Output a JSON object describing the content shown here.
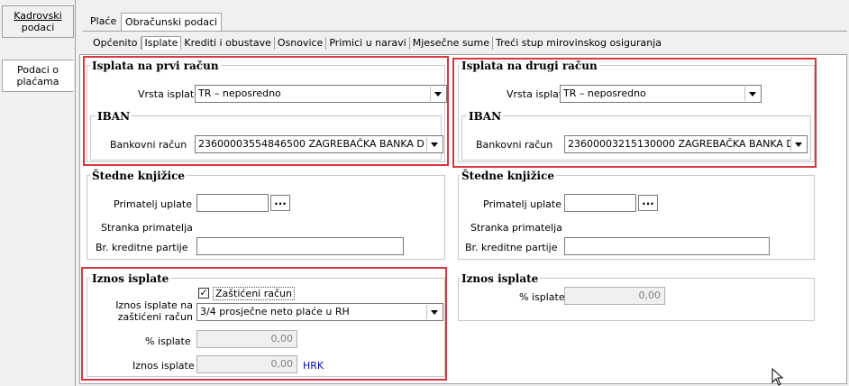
{
  "left_tabs": [
    {
      "label_line1": "Kadrovski",
      "label_line2": "podaci"
    },
    {
      "label_line1": "Podaci o",
      "label_line2": "plaćama"
    }
  ],
  "top_tabs": [
    "Plaće",
    "Obračunski podaci"
  ],
  "sub_tabs": [
    "Općenito",
    "Isplate",
    "Krediti i obustave",
    "Osnovice",
    "Primici u naravi",
    "Mjesečne sume",
    "Treći stup mirovinskog osiguranja"
  ],
  "first_account": {
    "title": "Isplata na prvi račun",
    "vrsta_label": "Vrsta isplate",
    "vrsta_value": "TR – neposredno",
    "iban_title": "IBAN",
    "bank_label": "Bankovni račun",
    "bank_value": "2360000355484650​0 ZAGREBAČKA BANKA D"
  },
  "second_account": {
    "title": "Isplata na drugi račun",
    "vrsta_label": "Vrsta isplate",
    "vrsta_value": "TR – neposredno",
    "iban_title": "IBAN",
    "bank_label": "Bankovni račun",
    "bank_value": "23600003215130000 ZAGREBAČKA BANKA D"
  },
  "savings_left": {
    "title": "Štedne knjižice",
    "recipient_label": "Primatelj uplate",
    "client_label": "Stranka primatelja",
    "credit_label": "Br. kreditne partije",
    "ellipsis": "..."
  },
  "savings_right": {
    "title": "Štedne knjižice",
    "recipient_label": "Primatelj uplate",
    "client_label": "Stranka primatelja",
    "credit_label": "Br. kreditne partije",
    "ellipsis": "..."
  },
  "amount_left": {
    "title": "Iznos isplate",
    "protected_label": "Zaštićeni račun",
    "protected_checked": true,
    "check_mark": "✓",
    "amount_on_label1": "Iznos isplate na",
    "amount_on_label2": "zaštićeni račun",
    "amount_on_value": "3/4 prosječne neto plaće u RH",
    "pct_label": "% isplate",
    "pct_value": "0,00",
    "amount_label": "Iznos isplate",
    "amount_value": "0,00",
    "currency": "HRK"
  },
  "amount_right": {
    "title": "Iznos isplate",
    "pct_label": "% isplate",
    "pct_value": "0,00"
  },
  "colors": {
    "highlight": "#d9363e",
    "currency": "#0000cc"
  }
}
